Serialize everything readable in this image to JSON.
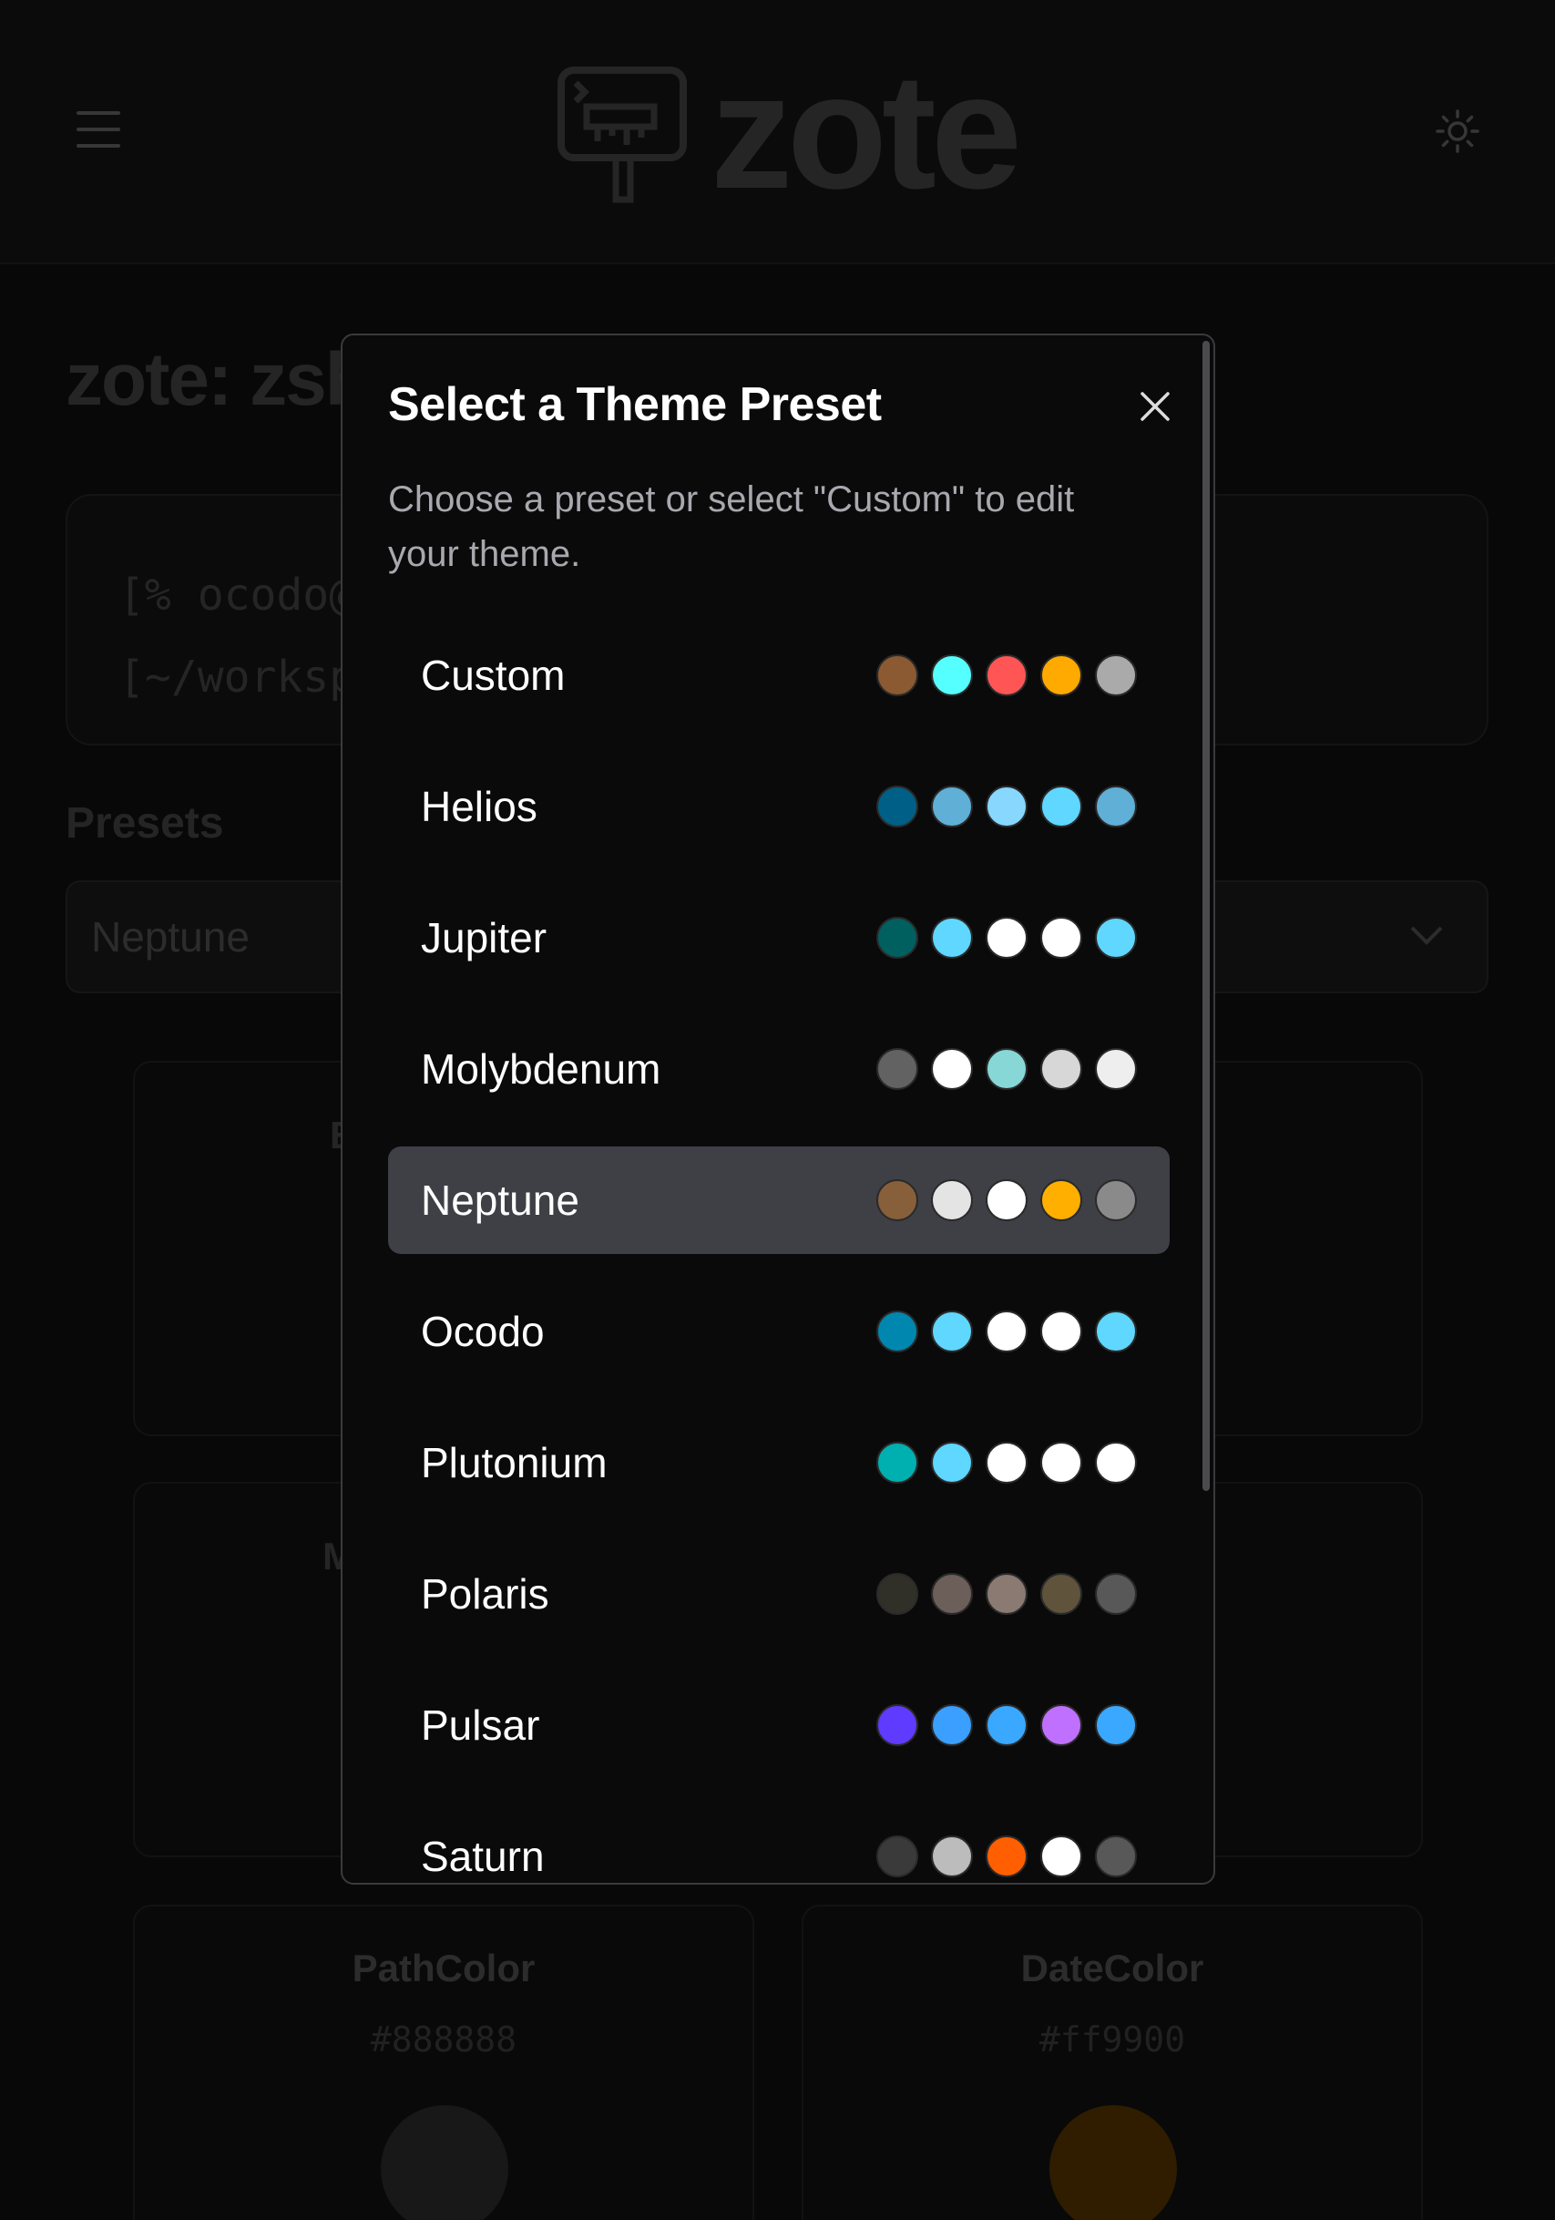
{
  "header": {
    "logo_text": "zote",
    "menu_icon": "menu-icon",
    "theme_icon": "sun-icon"
  },
  "page": {
    "title": "zote: zsh theme editor",
    "terminal_lines": [
      "[% ocodo@host]",
      "[~/workspace]"
    ],
    "presets_label": "Presets",
    "presets_value": "Neptune"
  },
  "cards": {
    "card1_label": "B",
    "card2_label": "M",
    "path": {
      "title": "PathColor",
      "hex": "#888888",
      "swatch": "#2a2a2a"
    },
    "date": {
      "title": "DateColor",
      "hex": "#ff9900",
      "swatch": "#4a2d00"
    }
  },
  "modal": {
    "title": "Select a Theme Preset",
    "description": "Choose a preset or select \"Custom\" to edit your theme.",
    "close_icon": "close-icon",
    "selected": "Neptune",
    "presets": [
      {
        "name": "Custom",
        "colors": [
          "#8b5a32",
          "#55ffff",
          "#ff5555",
          "#ffaa00",
          "#aaaaaa"
        ]
      },
      {
        "name": "Helios",
        "colors": [
          "#005f87",
          "#5fafd7",
          "#87d7ff",
          "#5fd7ff",
          "#5fafd7"
        ]
      },
      {
        "name": "Jupiter",
        "colors": [
          "#005f5f",
          "#5fd7ff",
          "#ffffff",
          "#ffffff",
          "#5fd7ff"
        ]
      },
      {
        "name": "Molybdenum",
        "colors": [
          "#626262",
          "#ffffff",
          "#87d7d7",
          "#d7d7d7",
          "#eeeeee"
        ]
      },
      {
        "name": "Neptune",
        "colors": [
          "#875f3a",
          "#e4e4e4",
          "#ffffff",
          "#ffaf00",
          "#8a8a8a"
        ]
      },
      {
        "name": "Ocodo",
        "colors": [
          "#0087af",
          "#5fd7ff",
          "#ffffff",
          "#ffffff",
          "#5fd7ff"
        ]
      },
      {
        "name": "Plutonium",
        "colors": [
          "#00afaf",
          "#5fd7ff",
          "#ffffff",
          "#ffffff",
          "#ffffff"
        ]
      },
      {
        "name": "Polaris",
        "colors": [
          "#303028",
          "#6c5f5a",
          "#8a7a72",
          "#5f533c",
          "#585858"
        ]
      },
      {
        "name": "Pulsar",
        "colors": [
          "#5f3aff",
          "#3a9fff",
          "#3aa8ff",
          "#c070ff",
          "#3aa8ff"
        ]
      },
      {
        "name": "Saturn",
        "colors": [
          "#3a3a3a",
          "#bcbcbc",
          "#ff5f00",
          "#ffffff",
          "#585858"
        ]
      }
    ]
  }
}
